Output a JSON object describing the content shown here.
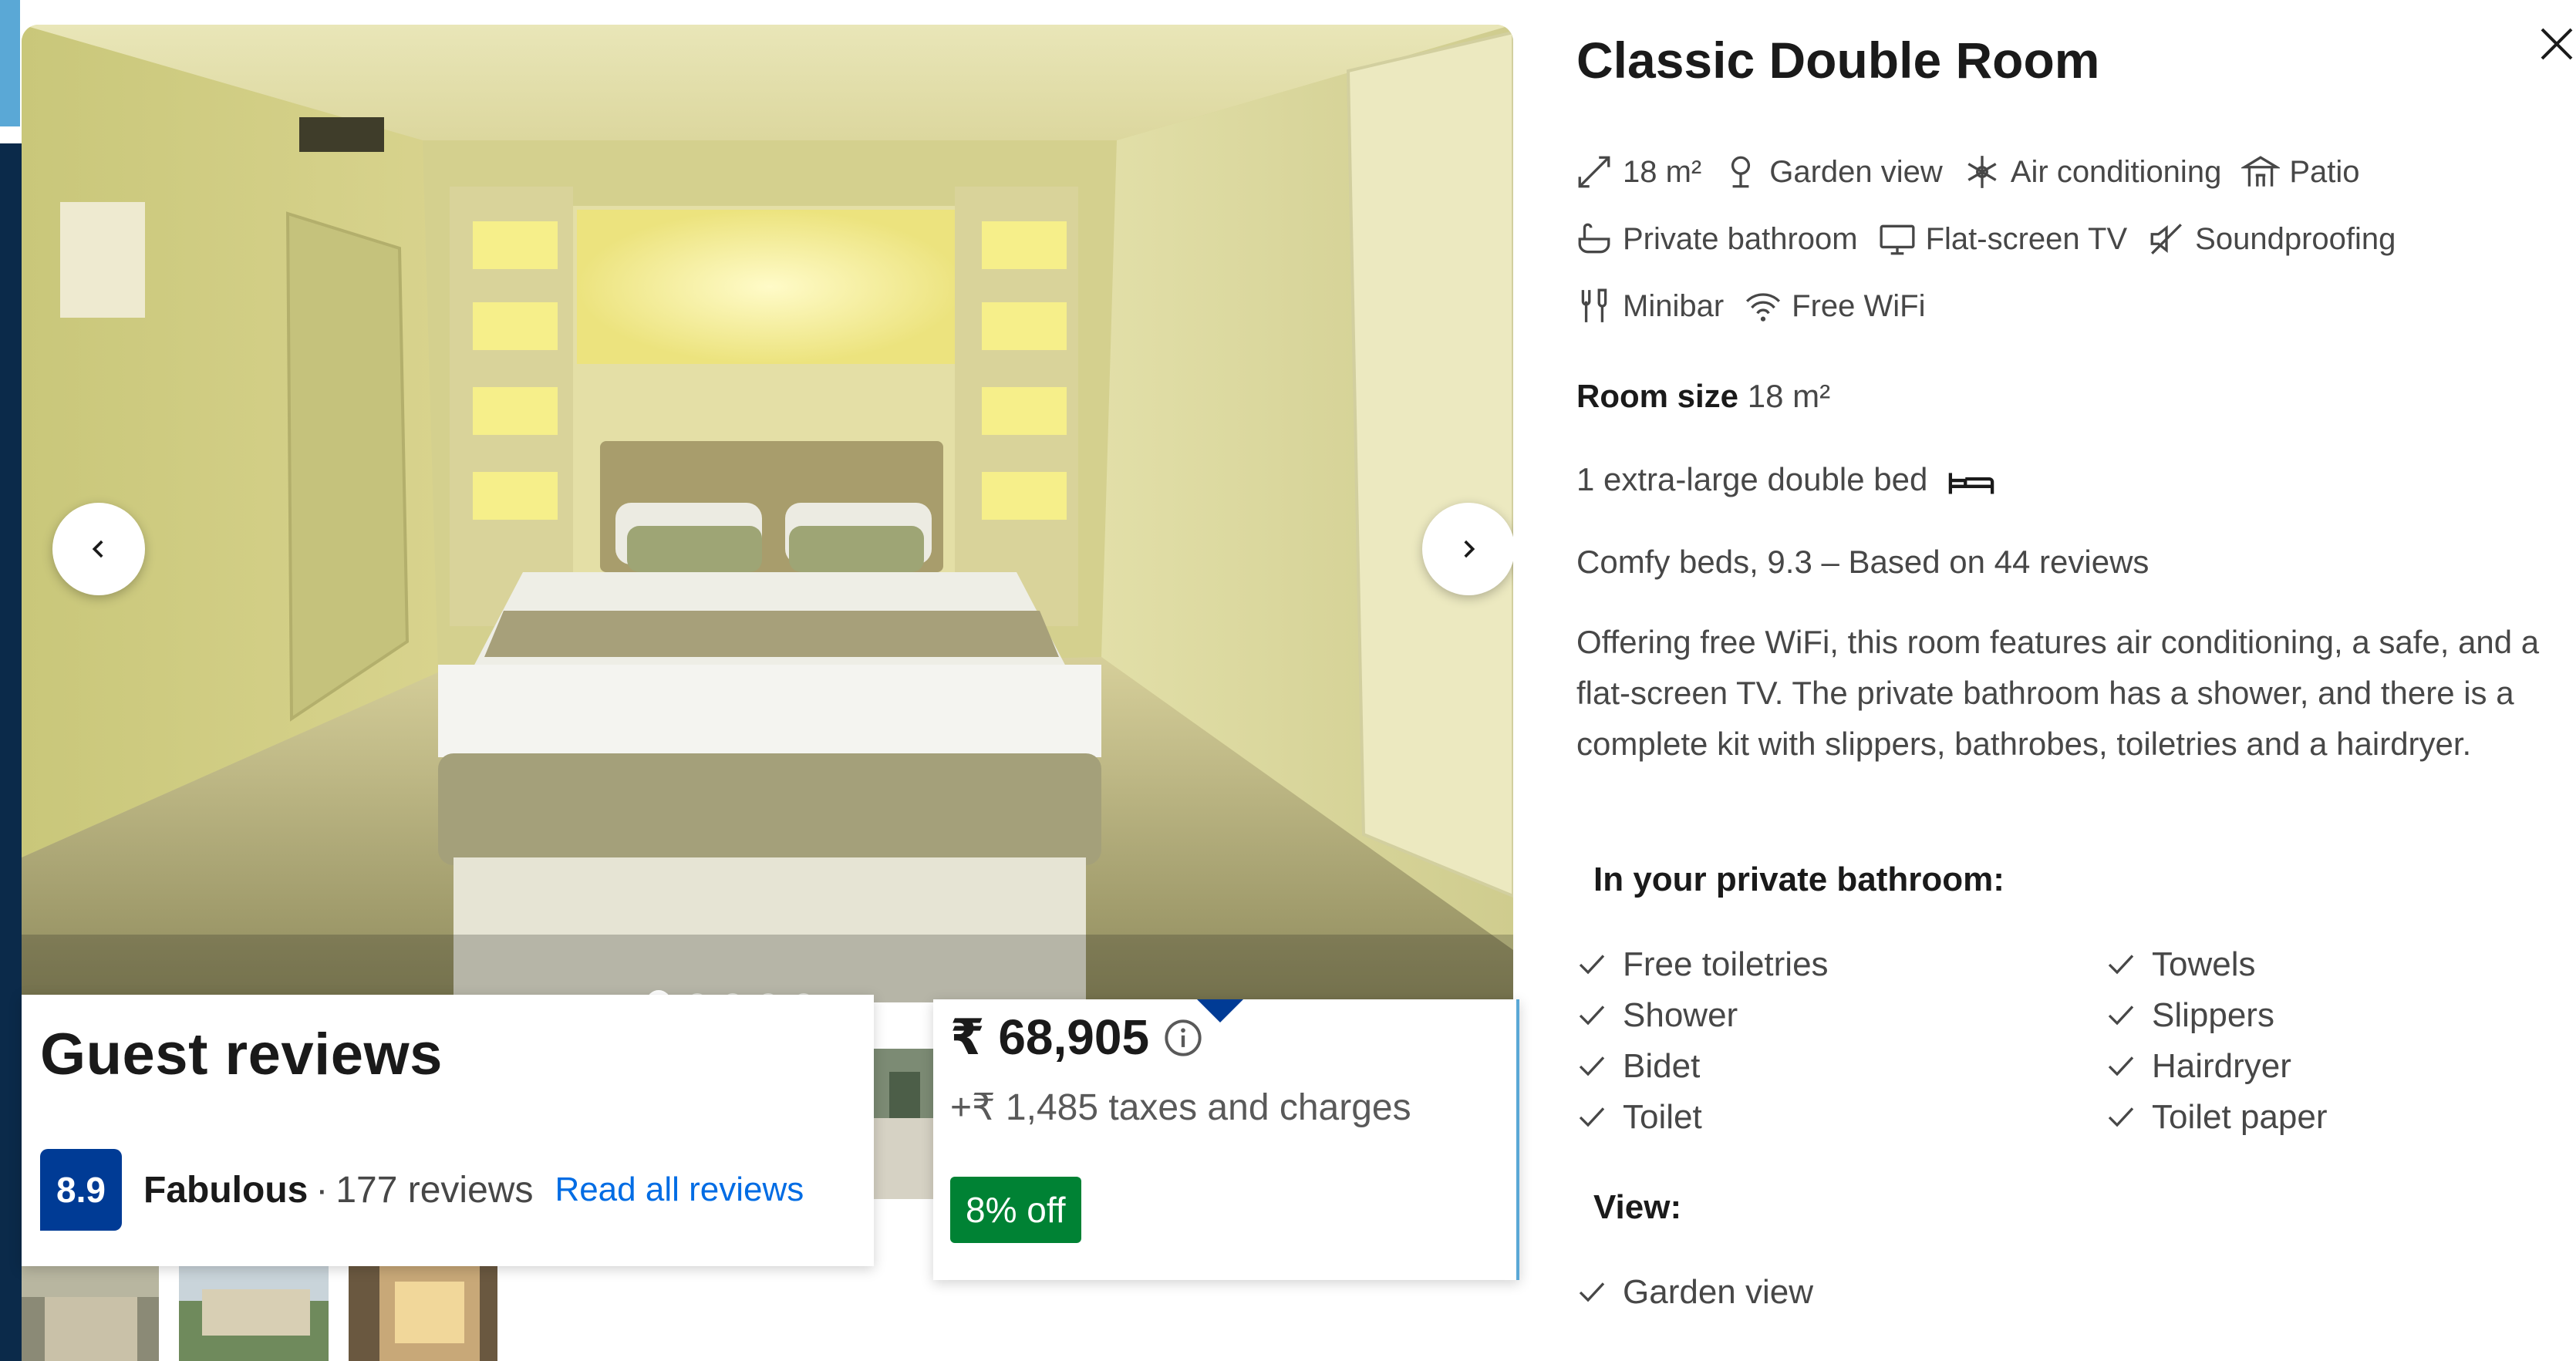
{
  "room": {
    "title": "Classic Double Room",
    "facilities": [
      {
        "icon": "room-size-icon",
        "label": "18 m²"
      },
      {
        "icon": "garden-view-icon",
        "label": "Garden view"
      },
      {
        "icon": "air-conditioning-icon",
        "label": "Air conditioning"
      },
      {
        "icon": "patio-icon",
        "label": "Patio"
      },
      {
        "icon": "private-bathroom-icon",
        "label": "Private bathroom"
      },
      {
        "icon": "tv-icon",
        "label": "Flat-screen TV"
      },
      {
        "icon": "soundproofing-icon",
        "label": "Soundproofing"
      },
      {
        "icon": "minibar-icon",
        "label": "Minibar"
      },
      {
        "icon": "wifi-icon",
        "label": "Free WiFi"
      }
    ],
    "room_size_label": "Room size",
    "room_size_value": "18 m²",
    "bed": "1 extra-large double bed",
    "comfy": "Comfy beds, 9.3 – Based on 44 reviews",
    "description": "Offering free WiFi, this room features air conditioning, a safe, and a flat-screen TV. The private bathroom has a shower, and there is a complete kit with slippers, bathrobes, toiletries and a hairdryer.",
    "bathroom_heading": "In your private bathroom:",
    "bathroom_left": [
      "Free toiletries",
      "Shower",
      "Bidet",
      "Toilet"
    ],
    "bathroom_right": [
      "Towels",
      "Slippers",
      "Hairdryer",
      "Toilet paper"
    ],
    "view_heading": "View:",
    "view_items": [
      "Garden view"
    ]
  },
  "reviews": {
    "title": "Guest reviews",
    "score": "8.9",
    "score_word": "Fabulous",
    "separator": "·",
    "count": "177 reviews",
    "link": "Read all reviews"
  },
  "price": {
    "amount": "₹ 68,905",
    "taxes": "+₹ 1,485 taxes and charges",
    "discount": "8% off"
  },
  "gallery": {
    "slide_index": 1,
    "slide_count": 7
  },
  "colors": {
    "brand_blue": "#003b95",
    "link_blue": "#006ce4",
    "discount_green": "#008234"
  }
}
